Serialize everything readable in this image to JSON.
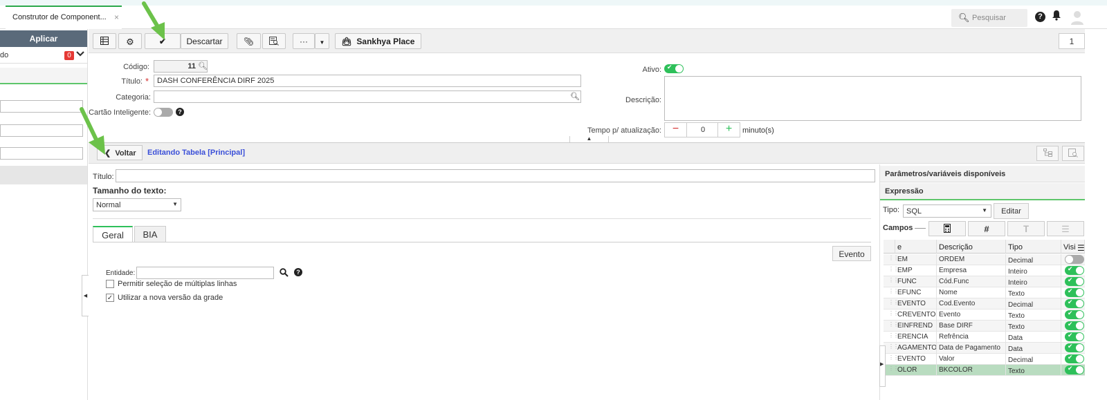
{
  "tab": {
    "title": "Construtor de Component...",
    "close": "×"
  },
  "topbar": {
    "search_placeholder": "Pesquisar",
    "help": "?"
  },
  "left": {
    "apply_label": "Aplicar",
    "row_text": "do",
    "badge_count": "0"
  },
  "toolbar": {
    "discard_label": "Descartar",
    "place_label": "Sankhya Place",
    "page": "1",
    "more": "···"
  },
  "form": {
    "codigo_label": "Código:",
    "codigo_value": "11",
    "titulo_label": "Título:",
    "required_mark": "*",
    "titulo_value": "DASH CONFERÊNCIA DIRF 2025",
    "categoria_label": "Categoria:",
    "categoria_value": "",
    "cartao_label": "Cartão Inteligente:",
    "ativo_label": "Ativo:",
    "descricao_label": "Descrição:",
    "tempo_label": "Tempo p/ atualização:",
    "tempo_value": "0",
    "tempo_unit": "minuto(s)"
  },
  "editbar": {
    "back_label": "Voltar",
    "editing_label": "Editando Tabela [Principal]"
  },
  "main": {
    "titulo_label": "Título:",
    "tamanho_label": "Tamanho do texto:",
    "tamanho_value": "Normal",
    "tabs": [
      "Geral",
      "BIA"
    ],
    "evento_label": "Evento",
    "entidade_label": "Entidade:",
    "multi_label": "Permitir seleção de múltiplas linhas",
    "nova_label": "Utilizar a nova versão da grade"
  },
  "right": {
    "params_label": "Parâmetros/variáveis disponíveis",
    "expr_label": "Expressão",
    "tipo_label": "Tipo:",
    "tipo_value": "SQL",
    "editar_label": "Editar",
    "campos_label": "Campos",
    "columns": [
      "e",
      "Descrição",
      "Tipo",
      "Visi"
    ],
    "rows": [
      {
        "nome": "EM",
        "descricao": "ORDEM",
        "tipo": "Decimal",
        "visible": false
      },
      {
        "nome": "EMP",
        "descricao": "Empresa",
        "tipo": "Inteiro",
        "visible": true
      },
      {
        "nome": "FUNC",
        "descricao": "Cód.Func",
        "tipo": "Inteiro",
        "visible": true
      },
      {
        "nome": "EFUNC",
        "descricao": "Nome",
        "tipo": "Texto",
        "visible": true
      },
      {
        "nome": "EVENTO",
        "descricao": "Cod.Evento",
        "tipo": "Decimal",
        "visible": true
      },
      {
        "nome": "CREVENTO",
        "descricao": "Evento",
        "tipo": "Texto",
        "visible": true
      },
      {
        "nome": "EINFREND",
        "descricao": "Base DIRF",
        "tipo": "Texto",
        "visible": true
      },
      {
        "nome": "ERENCIA",
        "descricao": "Refrência",
        "tipo": "Data",
        "visible": true
      },
      {
        "nome": "AGAMENTO",
        "descricao": "Data de Pagamento",
        "tipo": "Data",
        "visible": true
      },
      {
        "nome": "EVENTO",
        "descricao": "Valor",
        "tipo": "Decimal",
        "visible": true
      },
      {
        "nome": "OLOR",
        "descricao": "BKCOLOR",
        "tipo": "Texto",
        "visible": true
      }
    ]
  },
  "colors": {
    "accent_green": "#2ec05a",
    "link_blue": "#3a4fd8",
    "badge_red": "#e53935",
    "arrow_green": "#6cc24a"
  }
}
